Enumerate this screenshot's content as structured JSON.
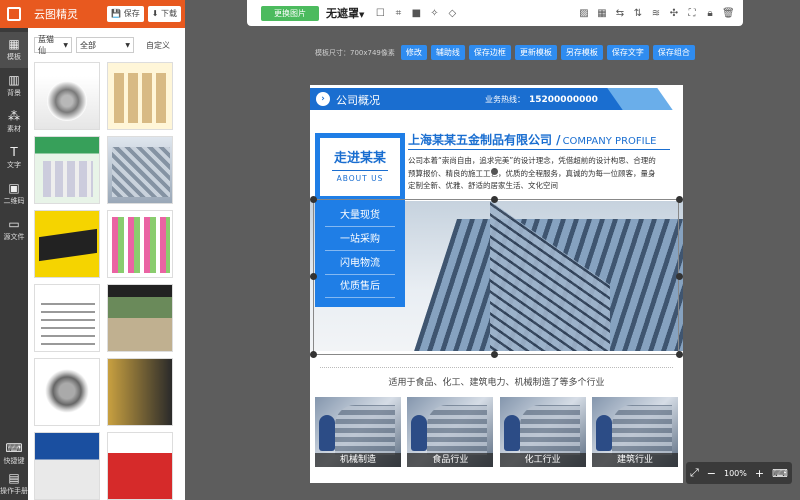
{
  "app": {
    "name": "云图精灵",
    "save": "保存",
    "download": "下载"
  },
  "rail": {
    "items": [
      {
        "label": "模板",
        "icon": "template-icon"
      },
      {
        "label": "背景",
        "icon": "background-icon"
      },
      {
        "label": "素材",
        "icon": "material-icon"
      },
      {
        "label": "文字",
        "icon": "text-icon"
      },
      {
        "label": "二维码",
        "icon": "qrcode-icon"
      },
      {
        "label": "源文件",
        "icon": "folder-icon"
      }
    ],
    "bottom": [
      {
        "label": "快捷键",
        "icon": "keyboard-icon"
      },
      {
        "label": "操作手册",
        "icon": "manual-icon"
      }
    ]
  },
  "panel": {
    "filter1": "蓝猫仙",
    "filter2": "全部",
    "custom": "自定义"
  },
  "toolbar": {
    "replace_image": "更换图片",
    "mode": "无遮罩"
  },
  "canvas_info": {
    "size": "模板尺寸：700x749像素",
    "actions": [
      "修改",
      "辅助线",
      "保存边框",
      "更新模板",
      "另存模板",
      "保存文字",
      "保存组合"
    ]
  },
  "poster": {
    "section_title": "公司概况",
    "hotline_label": "业务热线：",
    "hotline": "15200000000",
    "company_cn": "上海某某五金制品有限公司 /",
    "company_en": "COMPANY PROFILE",
    "description": "公司本着“崇尚自由，追求完美”的设计理念，凭借超前的设计构思、合理的预算报价、精良的施工工艺，优质的全程服务，真诚的为每一位顾客，量身定制全新、优雅、舒适的居家生活、文化空间",
    "box_title": "走进某某",
    "box_sub": "ABOUT US",
    "menu": [
      "大量现货",
      "一站采购",
      "闪电物流",
      "优质售后"
    ],
    "industry_text": "适用于食品、化工、建筑电力、机械制造了等多个行业",
    "cards": [
      "机械制造",
      "食品行业",
      "化工行业",
      "建筑行业"
    ]
  },
  "zoom": {
    "value": "100%"
  }
}
